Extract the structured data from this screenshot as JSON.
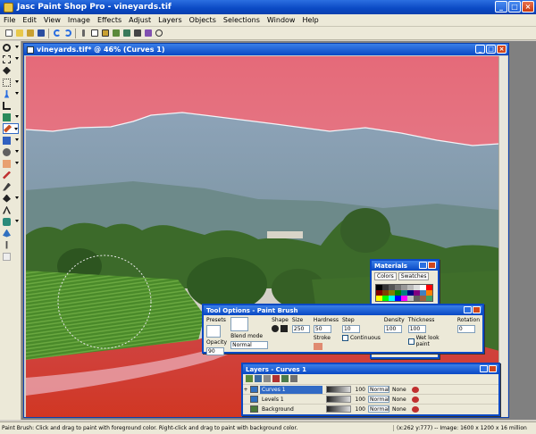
{
  "app": {
    "title": "Jasc Paint Shop Pro - vineyards.tif",
    "buttons": {
      "minimize": "_",
      "maximize": "□",
      "close": "×"
    }
  },
  "menu": [
    "File",
    "Edit",
    "View",
    "Image",
    "Effects",
    "Adjust",
    "Layers",
    "Objects",
    "Selections",
    "Window",
    "Help"
  ],
  "toolbar_icons": [
    "new-icon",
    "open-icon",
    "browse-icon",
    "save-icon",
    "undo-icon",
    "redo-icon",
    "cut-icon",
    "copy-icon",
    "paste-icon",
    "show-all-icon",
    "zoom-icon",
    "palette-icon",
    "script-icon",
    "help-icon"
  ],
  "tools": [
    "zoom-icon",
    "deform-icon",
    "move-icon",
    "selection-icon",
    "freehand-icon",
    "dropper-icon",
    "crop-icon",
    "straighten-icon",
    "paint-brush-icon",
    "clone-icon",
    "retouch-icon",
    "eraser-icon",
    "picture-tube-icon",
    "airbrush-icon",
    "flood-fill-icon",
    "text-icon",
    "preset-shape-icon",
    "pen-icon",
    "warp-icon"
  ],
  "image_window": {
    "title": "vineyards.tif* @ 46% (Curves 1)"
  },
  "materials": {
    "title": "Materials",
    "tabs": [
      "Colors",
      "Swatches"
    ],
    "swatch_colors": [
      "#000000",
      "#333333",
      "#555555",
      "#777777",
      "#999999",
      "#bbbbbb",
      "#dddddd",
      "#ffffff",
      "#ff0000",
      "#800000",
      "#804000",
      "#808000",
      "#008000",
      "#008080",
      "#000080",
      "#800080",
      "#4080c0",
      "#ff8000",
      "#ffff00",
      "#00ff00",
      "#00ffff",
      "#0000ff",
      "#ff00ff",
      "#c0c0c0",
      "#606060",
      "#a06040",
      "#40a060"
    ]
  },
  "tool_options": {
    "title": "Tool Options - Paint Brush",
    "labels": {
      "presets": "Presets",
      "shape": "Shape",
      "size": "Size",
      "hardness": "Hardness",
      "step": "Step",
      "density": "Density",
      "thickness": "Thickness",
      "rotation": "Rotation",
      "opacity": "Opacity",
      "blend_mode": "Blend mode",
      "stroke": "Stroke",
      "continuous": "Continuous",
      "wet_look": "Wet look paint"
    },
    "values": {
      "size": "250",
      "hardness": "50",
      "step": "10",
      "density": "100",
      "thickness": "100",
      "rotation": "0",
      "opacity": "90",
      "blend_mode": "Normal"
    }
  },
  "layers": {
    "title": "Layers - Curves 1",
    "rows": [
      {
        "name": "Curves 1",
        "opacity": "100",
        "blend": "Normal",
        "lock": "None",
        "selected": true
      },
      {
        "name": "Levels 1",
        "opacity": "100",
        "blend": "Normal",
        "lock": "None",
        "selected": false
      },
      {
        "name": "Background",
        "opacity": "100",
        "blend": "Normal",
        "lock": "None",
        "selected": false
      }
    ]
  },
  "status": {
    "message": "Paint Brush: Click and drag to paint with foreground color. Right-click and drag to paint with background color.",
    "info": "(x:262 y:777) -- Image: 1600 x 1200 x 16 million"
  }
}
